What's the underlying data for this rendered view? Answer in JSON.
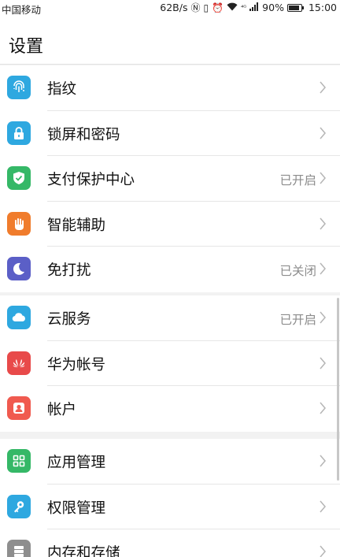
{
  "status_bar": {
    "carrier": "中国移动",
    "net_speed": "62B/s",
    "signal_label": "⁴ᴳ",
    "battery_percent": "90%",
    "battery_level": 0.9,
    "time": "15:00"
  },
  "header": {
    "title": "设置"
  },
  "groups": [
    {
      "items": [
        {
          "label": "指纹",
          "status": "",
          "icon": "fingerprint-icon",
          "color": "#2ea8e0"
        },
        {
          "label": "锁屏和密码",
          "status": "",
          "icon": "lock-icon",
          "color": "#2ea8e0"
        },
        {
          "label": "支付保护中心",
          "status": "已开启",
          "icon": "shield-check-icon",
          "color": "#35b867"
        },
        {
          "label": "智能辅助",
          "status": "",
          "icon": "hand-icon",
          "color": "#f07c2c"
        },
        {
          "label": "免打扰",
          "status": "已关闭",
          "icon": "moon-icon",
          "color": "#5b5fc7"
        }
      ]
    },
    {
      "items": [
        {
          "label": "云服务",
          "status": "已开启",
          "icon": "cloud-icon",
          "color": "#2ea8e0"
        },
        {
          "label": "华为帐号",
          "status": "",
          "icon": "huawei-logo-icon",
          "color": "#e84a4a"
        },
        {
          "label": "帐户",
          "status": "",
          "icon": "account-icon",
          "color": "#f05a4f"
        }
      ]
    },
    {
      "items": [
        {
          "label": "应用管理",
          "status": "",
          "icon": "apps-grid-icon",
          "color": "#35b867"
        },
        {
          "label": "权限管理",
          "status": "",
          "icon": "key-icon",
          "color": "#2ea8e0"
        },
        {
          "label": "内存和存储",
          "status": "",
          "icon": "storage-icon",
          "color": "#8e8e8e"
        }
      ]
    }
  ]
}
